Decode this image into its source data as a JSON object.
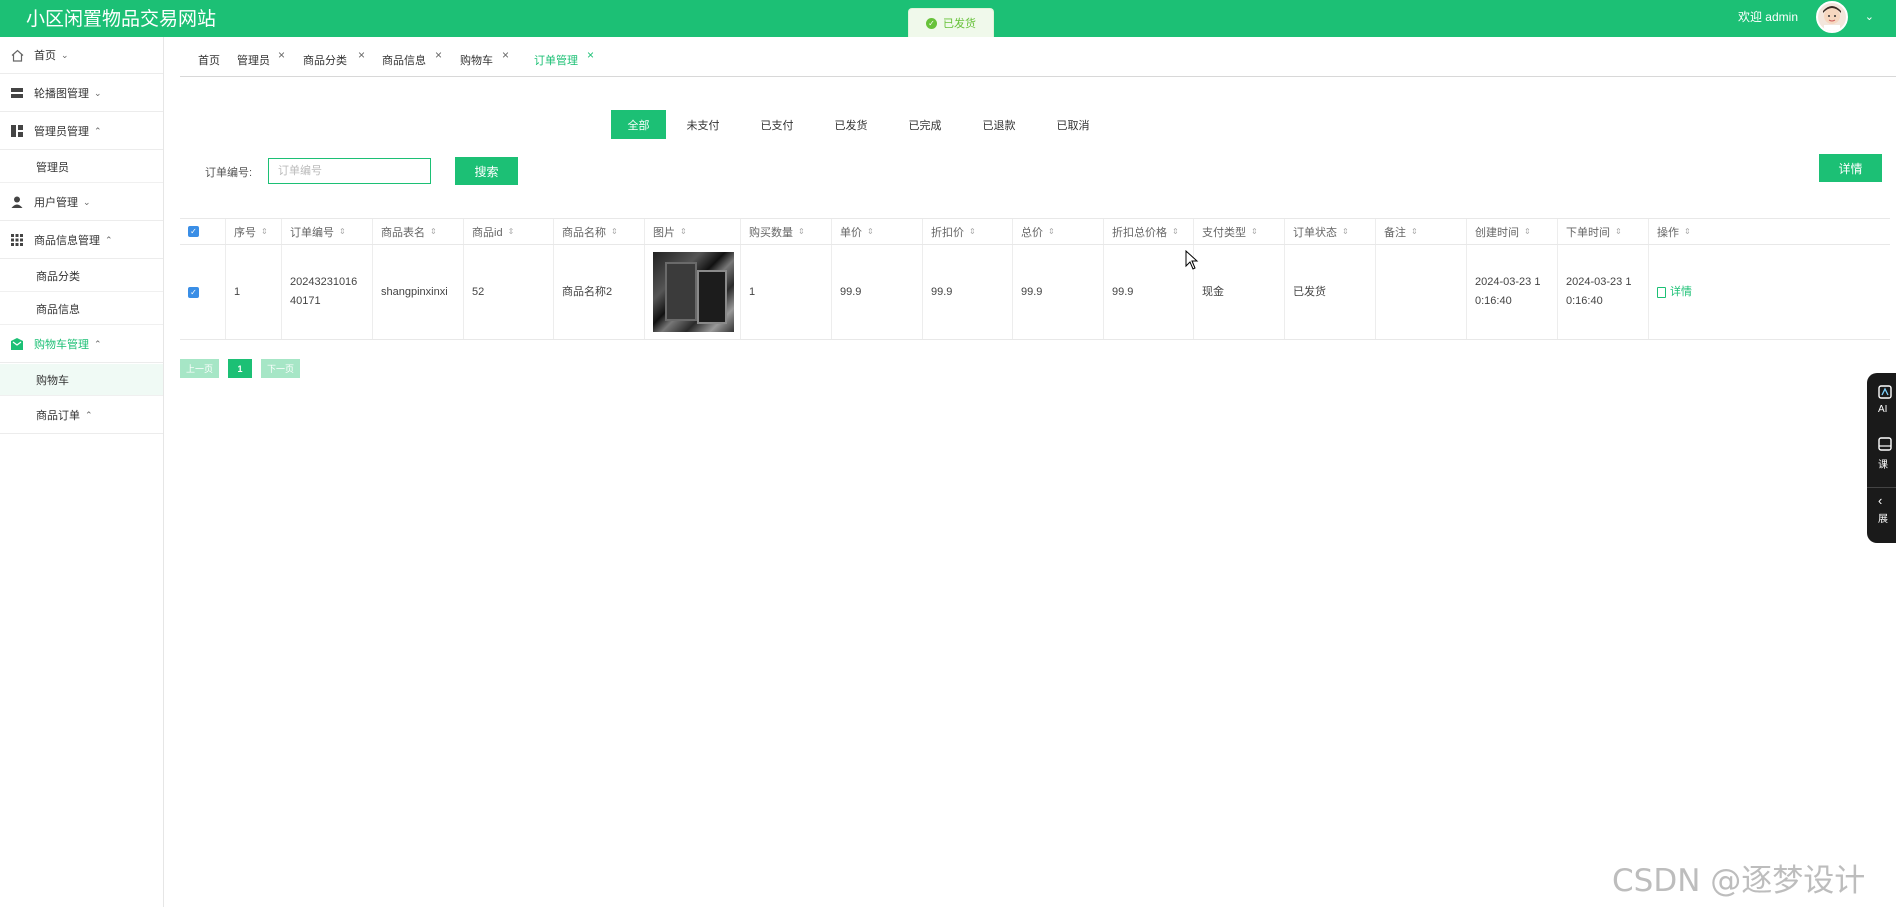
{
  "header": {
    "title": "小区闲置物品交易网站",
    "welcome": "欢迎 admin"
  },
  "toast": {
    "text": "已发货"
  },
  "sidebar": {
    "items": [
      {
        "label": "首页",
        "icon": "home-icon"
      },
      {
        "label": "轮播图管理",
        "icon": "carousel-icon"
      },
      {
        "label": "管理员管理",
        "icon": "dashboard-icon"
      },
      {
        "label": "管理员",
        "sub": true
      },
      {
        "label": "用户管理",
        "icon": "user-icon"
      },
      {
        "label": "商品信息管理",
        "icon": "grid-icon"
      },
      {
        "label": "商品分类",
        "sub": true
      },
      {
        "label": "商品信息",
        "sub": true
      },
      {
        "label": "购物车管理",
        "icon": "cart-icon"
      },
      {
        "label": "购物车",
        "sub": true
      },
      {
        "label": "商品订单",
        "sub": true
      }
    ]
  },
  "tabs": [
    "首页",
    "管理员",
    "商品分类",
    "商品信息",
    "购物车",
    "订单管理"
  ],
  "status_tabs": [
    "全部",
    "未支付",
    "已支付",
    "已发货",
    "已完成",
    "已退款",
    "已取消"
  ],
  "search": {
    "label": "订单编号:",
    "placeholder": "订单编号",
    "button": "搜索",
    "detail_button": "详情"
  },
  "table": {
    "headers": [
      "序号",
      "订单编号",
      "商品表名",
      "商品id",
      "商品名称",
      "图片",
      "购买数量",
      "单价",
      "折扣价",
      "总价",
      "折扣总价格",
      "支付类型",
      "订单状态",
      "备注",
      "创建时间",
      "下单时间",
      "操作"
    ],
    "rows": [
      {
        "index": "1",
        "order_no_1": "20243231016",
        "order_no_2": "40171",
        "table_name": "shangpinxinxi",
        "goods_id": "52",
        "goods_name": "商品名称2",
        "quantity": "1",
        "price": "99.9",
        "discount_price": "99.9",
        "total": "99.9",
        "discount_total": "99.9",
        "pay_type": "现金",
        "status": "已发货",
        "remark": "",
        "created_1": "2024-03-23 1",
        "created_2": "0:16:40",
        "ordered_1": "2024-03-23 1",
        "ordered_2": "0:16:40",
        "action": "详情"
      }
    ]
  },
  "pager": {
    "prev": "上一页",
    "current": "1",
    "next": "下一页"
  },
  "float_panel": {
    "items": [
      "AI",
      "课",
      "展"
    ]
  },
  "watermark": "CSDN @逐梦设计",
  "colors": {
    "primary": "#1cc075",
    "toast_text": "#67c23a",
    "checkbox": "#3a8ee6"
  }
}
